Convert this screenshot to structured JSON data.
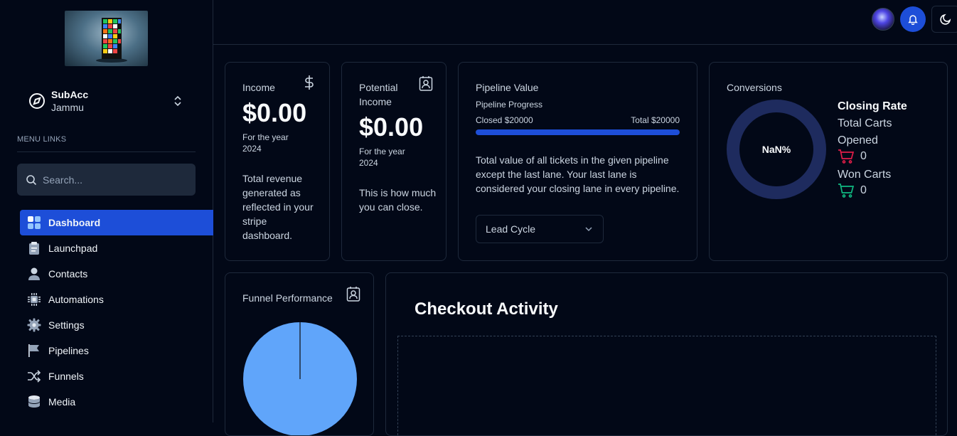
{
  "sidebar": {
    "account": {
      "name": "SubAcc",
      "location": "Jammu"
    },
    "menu_label": "MENU LINKS",
    "search": {
      "placeholder": "Search..."
    },
    "items": [
      {
        "label": "Dashboard",
        "icon": "dashboard-icon",
        "active": true
      },
      {
        "label": "Launchpad",
        "icon": "clipboard-icon"
      },
      {
        "label": "Contacts",
        "icon": "person-icon"
      },
      {
        "label": "Automations",
        "icon": "chip-icon"
      },
      {
        "label": "Settings",
        "icon": "gear-icon"
      },
      {
        "label": "Pipelines",
        "icon": "flag-icon"
      },
      {
        "label": "Funnels",
        "icon": "shuffle-icon"
      },
      {
        "label": "Media",
        "icon": "database-icon"
      }
    ]
  },
  "header": {
    "notifications_icon": "bell-icon",
    "theme_icon": "moon-icon"
  },
  "cards": {
    "income": {
      "title": "Income",
      "value": "$0.00",
      "period": "For the year 2024",
      "description": "Total revenue generated as reflected in your stripe dashboard.",
      "icon": "dollar-icon"
    },
    "potential": {
      "title": "Potential Income",
      "value": "$0.00",
      "period": "For the year 2024",
      "description": "This is how much you can close.",
      "icon": "contact-card-icon"
    },
    "pipeline": {
      "title": "Pipeline Value",
      "subtitle": "Pipeline Progress",
      "closed": "Closed $20000",
      "total": "Total $20000",
      "progress": 1.0,
      "description": "Total value of all tickets in the given pipeline except the last lane. Your last lane is considered your closing lane in every pipeline.",
      "select_value": "Lead Cycle"
    },
    "conversions": {
      "title": "Conversions",
      "percent": "NaN%",
      "closing_rate": "Closing Rate",
      "total_carts_label": "Total Carts Opened",
      "total_carts": "0",
      "won_carts_label": "Won Carts",
      "won_carts": "0"
    },
    "funnel": {
      "title": "Funnel Performance",
      "icon": "contact-card-icon"
    },
    "checkout": {
      "title": "Checkout Activity"
    }
  },
  "colors": {
    "accent": "#1d4ed8",
    "donut": "#1e2b5e",
    "pie": "#60a5fa",
    "cart_red": "#e11d48",
    "cart_green": "#10b981"
  }
}
